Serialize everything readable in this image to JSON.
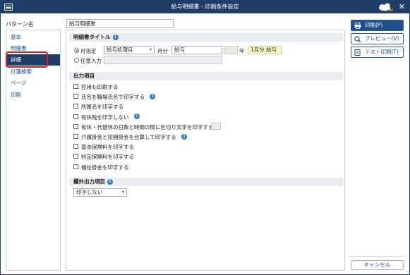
{
  "window": {
    "title": "給与明細書 - 印刷条件設定"
  },
  "left": {
    "pattern_label": "パターン名",
    "nav": [
      {
        "label": "基本"
      },
      {
        "label": "明細書"
      },
      {
        "label": "詳細"
      },
      {
        "label": "付箋検索"
      },
      {
        "label": "ページ"
      },
      {
        "label": "印刷"
      }
    ],
    "selected_index": 2
  },
  "pattern_name": {
    "value": "給与明細書"
  },
  "title_section": {
    "heading": "明細書タイトル",
    "month_radio_label": "月指定",
    "month_select_value": "給与処理月",
    "month_suffix": "月分",
    "month_text_value": "給与",
    "preview_year": "年",
    "preview_text": "1月分 給与",
    "free_radio_label": "任意入力"
  },
  "output_section": {
    "heading": "出力項目",
    "items": [
      {
        "label": "控用も印刷する",
        "info": false,
        "extra_box": false
      },
      {
        "label": "氏名を職場氏名で印字する",
        "info": true,
        "extra_box": false
      },
      {
        "label": "所属名を印字する",
        "info": false,
        "extra_box": false
      },
      {
        "label": "有休残を印字しない",
        "info": true,
        "extra_box": false
      },
      {
        "label": "有休・代替休の日数と時間の間に区切り文字を印字する",
        "info": false,
        "extra_box": true
      },
      {
        "label": "介護掛金と短期掛金を合算して印字する",
        "info": true,
        "extra_box": false
      },
      {
        "label": "基本保険料を印字する",
        "info": false,
        "extra_box": false
      },
      {
        "label": "特定保険料を印字する",
        "info": false,
        "extra_box": false
      },
      {
        "label": "福祉掛金を印字する",
        "info": false,
        "extra_box": false
      }
    ]
  },
  "extra_section": {
    "heading": "欄外出力項目",
    "select_value": "印字しない"
  },
  "actions": {
    "print": "印刷(P)",
    "preview": "プレビュー(V)",
    "test_print": "テスト印刷(T)",
    "cancel": "キャンセル"
  },
  "colors": {
    "titlebar": "#1f3d66",
    "accent": "#1f4e8c",
    "link": "#1b4e96",
    "highlight": "#e01919",
    "info": "#2f7ec9"
  }
}
